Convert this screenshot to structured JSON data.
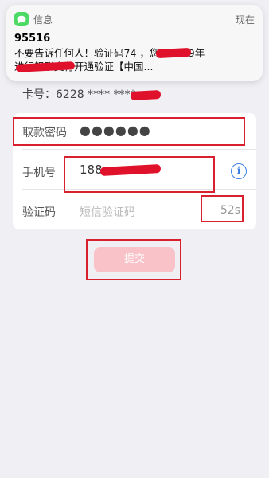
{
  "notification": {
    "app_name": "信息",
    "time": "现在",
    "sender": "95516",
    "line1": "不要告诉任何人！验证码74       ，您于2019年",
    "line2": "                       进行银联支付开通验证【中国...",
    "icon": "message-bubble-icon",
    "icon_color": "#4cd964"
  },
  "card_number": "卡号：6228 **** ****",
  "form": {
    "password": {
      "label": "取款密码",
      "value": "●●●●●●"
    },
    "phone": {
      "label": "手机号",
      "value": "188",
      "icon": "info-icon"
    },
    "code": {
      "label": "验证码",
      "placeholder": "短信验证码",
      "countdown": "52s"
    }
  },
  "submit_label": "提交",
  "colors": {
    "annotation": "#d9202f",
    "redaction": "#e0112b",
    "submit_bg": "#f8c2c8",
    "info": "#3a7ee4"
  }
}
